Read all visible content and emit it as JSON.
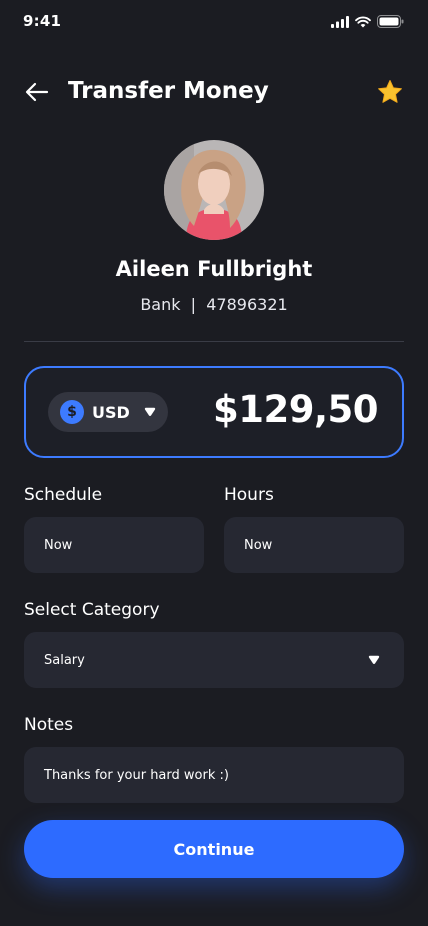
{
  "status_bar": {
    "time": "9:41"
  },
  "header": {
    "title": "Transfer Money",
    "back_icon": "arrow-left-icon",
    "favorite_icon": "star-icon"
  },
  "recipient": {
    "name": "Aileen Fullbright",
    "bank_info": "Bank  |  47896321"
  },
  "amount": {
    "currency": "USD",
    "currency_symbol": "$",
    "value": "$129,50"
  },
  "schedule": {
    "label": "Schedule",
    "value": "Now"
  },
  "hours": {
    "label": "Hours",
    "value": "Now"
  },
  "category": {
    "label": "Select Category",
    "value": "Salary"
  },
  "notes": {
    "label": "Notes",
    "value": "Thanks for your hard work :)"
  },
  "actions": {
    "continue_label": "Continue"
  },
  "colors": {
    "background": "#1b1c22",
    "field": "#262832",
    "accent": "#2d6bff",
    "star": "#f9c22e"
  }
}
